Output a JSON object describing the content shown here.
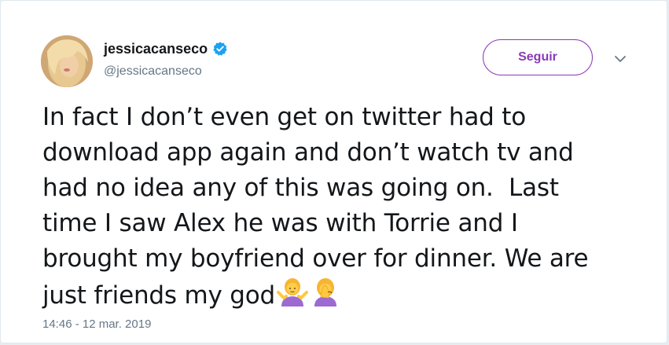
{
  "author": {
    "display_name": "jessicacanseco",
    "handle": "@jessicacanseco",
    "verified": true,
    "avatar": "profile-photo"
  },
  "follow_button": {
    "label": "Seguir"
  },
  "menu": {
    "icon": "chevron-down-icon"
  },
  "tweet": {
    "lines": [
      "In fact I don’t even get on twitter had to",
      "download app again and don’t watch tv and",
      "had no idea any of this was going on.  Last",
      "time I saw Alex he was with Torrie and I",
      "brought my boyfriend over for dinner. We are",
      "just friends my god"
    ],
    "emojis": [
      "woman-shrugging-emoji",
      "woman-facepalming-emoji"
    ]
  },
  "timestamp": "14:46 - 12 mar. 2019",
  "colors": {
    "accent": "#8a3ab9",
    "verified": "#1da1f2",
    "muted": "#657786",
    "text": "#14171a"
  }
}
